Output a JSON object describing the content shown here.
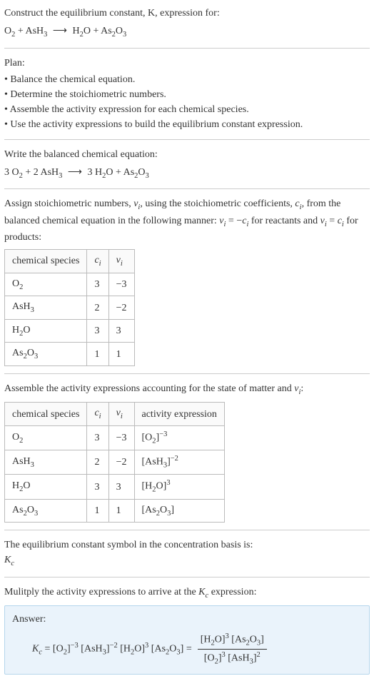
{
  "prompt": {
    "line1": "Construct the equilibrium constant, K, expression for:",
    "eq_lhs1": "O",
    "eq_lhs1_sub": "2",
    "eq_plus1": " + AsH",
    "eq_lhs2_sub": "3",
    "eq_arrow": "⟶",
    "eq_rhs1": "H",
    "eq_rhs1_sub": "2",
    "eq_rhs1b": "O + As",
    "eq_rhs2_sub": "2",
    "eq_rhs2b": "O",
    "eq_rhs3_sub": "3"
  },
  "plan": {
    "title": "Plan:",
    "items": [
      "• Balance the chemical equation.",
      "• Determine the stoichiometric numbers.",
      "• Assemble the activity expression for each chemical species.",
      "• Use the activity expressions to build the equilibrium constant expression."
    ]
  },
  "balanced": {
    "title": "Write the balanced chemical equation:",
    "c1": "3 O",
    "c1_sub": "2",
    "c2": " + 2 AsH",
    "c2_sub": "3",
    "arrow": "⟶",
    "c3": "3 H",
    "c3_sub": "2",
    "c3b": "O + As",
    "c4_sub": "2",
    "c4b": "O",
    "c5_sub": "3"
  },
  "assign": {
    "text_a": "Assign stoichiometric numbers, ",
    "nu": "ν",
    "nu_sub": "i",
    "text_b": ", using the stoichiometric coefficients, ",
    "ci": "c",
    "ci_sub": "i",
    "text_c": ", from the balanced chemical equation in the following manner: ",
    "rel1_a": "ν",
    "rel1_b": " = −",
    "rel1_c": "c",
    "text_d": " for reactants and ",
    "rel2_a": "ν",
    "rel2_b": " = ",
    "rel2_c": "c",
    "text_e": " for products:"
  },
  "table1": {
    "headers": {
      "species": "chemical species",
      "ci": "c",
      "ci_sub": "i",
      "nu": "ν",
      "nu_sub": "i"
    },
    "rows": [
      {
        "sp_a": "O",
        "sp_sub": "2",
        "ci": "3",
        "nu": "−3"
      },
      {
        "sp_a": "AsH",
        "sp_sub": "3",
        "ci": "2",
        "nu": "−2"
      },
      {
        "sp_a": "H",
        "sp_sub": "2",
        "sp_b": "O",
        "ci": "3",
        "nu": "3"
      },
      {
        "sp_a": "As",
        "sp_sub": "2",
        "sp_b": "O",
        "sp_sub2": "3",
        "ci": "1",
        "nu": "1"
      }
    ]
  },
  "assemble": {
    "text_a": "Assemble the activity expressions accounting for the state of matter and ",
    "nu": "ν",
    "nu_sub": "i",
    "text_b": ":"
  },
  "table2": {
    "headers": {
      "species": "chemical species",
      "ci": "c",
      "ci_sub": "i",
      "nu": "ν",
      "nu_sub": "i",
      "act": "activity expression"
    },
    "rows": [
      {
        "sp_a": "O",
        "sp_sub": "2",
        "ci": "3",
        "nu": "−3",
        "act_a": "[O",
        "act_sub": "2",
        "act_b": "]",
        "act_sup": "−3"
      },
      {
        "sp_a": "AsH",
        "sp_sub": "3",
        "ci": "2",
        "nu": "−2",
        "act_a": "[AsH",
        "act_sub": "3",
        "act_b": "]",
        "act_sup": "−2"
      },
      {
        "sp_a": "H",
        "sp_sub": "2",
        "sp_b": "O",
        "ci": "3",
        "nu": "3",
        "act_a": "[H",
        "act_sub": "2",
        "act_b": "O]",
        "act_sup": "3"
      },
      {
        "sp_a": "As",
        "sp_sub": "2",
        "sp_b": "O",
        "sp_sub2": "3",
        "ci": "1",
        "nu": "1",
        "act_a": "[As",
        "act_sub": "2",
        "act_b": "O",
        "act_sub2": "3",
        "act_c": "]"
      }
    ]
  },
  "kc_symbol": {
    "text": "The equilibrium constant symbol in the concentration basis is:",
    "sym": "K",
    "sym_sub": "c"
  },
  "multiply": {
    "text_a": "Mulitply the activity expressions to arrive at the ",
    "kc": "K",
    "kc_sub": "c",
    "text_b": " expression:"
  },
  "answer": {
    "label": "Answer:",
    "lhs_k": "K",
    "lhs_sub": "c",
    "eq": " = ",
    "t1a": "[O",
    "t1sub": "2",
    "t1b": "]",
    "t1sup": "−3",
    "t2a": " [AsH",
    "t2sub": "3",
    "t2b": "]",
    "t2sup": "−2",
    "t3a": " [H",
    "t3sub": "2",
    "t3b": "O]",
    "t3sup": "3",
    "t4a": " [As",
    "t4sub": "2",
    "t4b": "O",
    "t4sub2": "3",
    "t4c": "]",
    "eq2": " = ",
    "num_a": "[H",
    "num_sub1": "2",
    "num_b": "O]",
    "num_sup1": "3",
    "num_c": " [As",
    "num_sub2": "2",
    "num_d": "O",
    "num_sub3": "3",
    "num_e": "]",
    "den_a": "[O",
    "den_sub1": "2",
    "den_b": "]",
    "den_sup1": "3",
    "den_c": " [AsH",
    "den_sub2": "3",
    "den_d": "]",
    "den_sup2": "2"
  }
}
